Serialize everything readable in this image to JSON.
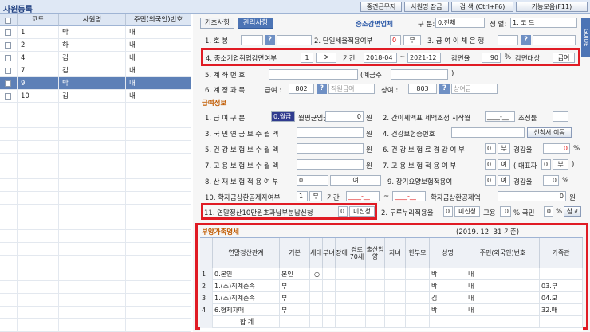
{
  "window": {
    "title": "사원등록"
  },
  "toolbar": {
    "btn1": "중견근무지",
    "btn2": "사원명 잠금",
    "btn3": "검 색 (Ctrl+F6)",
    "btn4": "기능모음(F11)"
  },
  "left": {
    "headers": [
      "코드",
      "사원명",
      "주민(외국인)번호"
    ],
    "rows": [
      {
        "code": "1",
        "name": "박",
        "id": "내",
        "sel": false
      },
      {
        "code": "2",
        "name": "하",
        "id": "내",
        "sel": false
      },
      {
        "code": "4",
        "name": "김",
        "id": "내",
        "sel": false
      },
      {
        "code": "7",
        "name": "김",
        "id": "내",
        "sel": false
      },
      {
        "code": "9",
        "name": "박",
        "id": "내",
        "sel": true
      },
      {
        "code": "10",
        "name": "김",
        "id": "내",
        "sel": false
      }
    ]
  },
  "tabs": {
    "t1": "기초사항",
    "t2": "관리사항"
  },
  "topright": {
    "sme_label": "중소감면업체",
    "div_label": "구 분:",
    "div_val": "0.전체",
    "sort_label": "정 렬:",
    "sort_val": "1. 코 드",
    "guide": "GUIDE"
  },
  "mgmt": {
    "r1a": "1. 호   봉",
    "r1b": "2. 단일세율적용여부",
    "r1b_v": "0",
    "r1b_n": "부",
    "r1c": "3. 급 여 이 체 은 행",
    "r4": "4. 중소기업취업감면여부",
    "r4_v": "1",
    "r4_yes": "여",
    "r4_period": "기간",
    "r4_from": "2018-04",
    "r4_to": "2021-12",
    "r4_rate_lbl": "감면율",
    "r4_rate": "90",
    "r4_pct": "%",
    "r4_target_lbl": "감면대상",
    "r4_target": "급여",
    "r5": "5. 계   좌   번   호",
    "r5_holder": "(예금주",
    "r5_close": ")",
    "r6": "6. 계 정 과 목",
    "r6_sal": "급여 :",
    "r6_sal_v": "802",
    "r6_sal_n": "직원급여",
    "r6_bonus": "상여 :",
    "r6_bonus_v": "803",
    "r6_bonus_n": "상여금"
  },
  "pay": {
    "title": "급여정보",
    "l1": "1. 급 여 구 분",
    "l1_v": "0.월급",
    "l1_avg": "월평균임금",
    "l1_amt": "0",
    "won": "원",
    "l2": "2. 간이세액표 세액조정 시작월",
    "l2_v": "____-__",
    "l2_adj": "조정률",
    "l3": "3. 국 민 연 금 보 수 월 액",
    "l4": "4. 건강보험증번호",
    "l4_btn": "신청서 이동",
    "l5": "5. 건 강 보 험 보 수 월 액",
    "l6": "6. 건 강 보 험 료 경 감 여 부",
    "l6_v": "0",
    "l6_n": "부",
    "l6_red": "경감율",
    "l6_rate": "0",
    "pct": "%",
    "l7": "7. 고 용 보 험 보 수 월 액",
    "l8": "7. 고 용 보 험 적 용 여 부",
    "l8_v": "0",
    "l8_n": "여",
    "l8_rep": "( 대표자",
    "l8_rep_v": "0",
    "l8_rep_n": "부",
    "close": ")",
    "l9": "8. 산 재 보 험 적 용 여 부",
    "l9_v": "0",
    "l9_n": "여",
    "l10": "9. 장기요양보험적용여",
    "l10_v": "0",
    "l10_n": "여",
    "l10_red": "경감율",
    "l10_rate": "0",
    "l11": "10. 학자금상환공제자여부",
    "l11_v": "1",
    "l11_n": "부",
    "l11_period": "기간",
    "l11_from": "____-__",
    "l11_to": "____-__",
    "l11_amt_lbl": "학자금상환공제액",
    "l11_amt": "0",
    "l12": "11. 연말정산10만원초과납부분납신청",
    "l12_v": "0",
    "l12_n": "미신청",
    "l13": "2. 두루누리적용율",
    "l13_v": "0",
    "l13_n": "미신청",
    "l13_emp": "고용",
    "l13_emp_v": "0",
    "l13_pct": "% 국민",
    "l13_nat_v": "0",
    "l13_pct2": "%",
    "l13_ref": "참고"
  },
  "family": {
    "title": "부양가족명세",
    "date": "(2019. 12. 31 기준)",
    "headers": [
      "연말정산관계",
      "기본",
      "세대",
      "부녀",
      "장애",
      "경로70세",
      "출산입양",
      "자녀",
      "한부모",
      "성명",
      "주민(외국인)번호",
      "가족관"
    ],
    "rows": [
      {
        "no": "1",
        "rel": "0.본인",
        "basic": "본인",
        "hh": "○",
        "name": "박",
        "id": "내",
        "fam": ""
      },
      {
        "no": "2",
        "rel": "1.(소)직계존속",
        "basic": "부",
        "hh": "",
        "name": "박",
        "id": "내",
        "fam": "03.부"
      },
      {
        "no": "3",
        "rel": "1.(소)직계존속",
        "basic": "부",
        "hh": "",
        "name": "김",
        "id": "내",
        "fam": "04.모"
      },
      {
        "no": "4",
        "rel": "6.형제자매",
        "basic": "부",
        "hh": "",
        "name": "박",
        "id": "내",
        "fam": "32.매"
      }
    ],
    "total": "합   계"
  }
}
